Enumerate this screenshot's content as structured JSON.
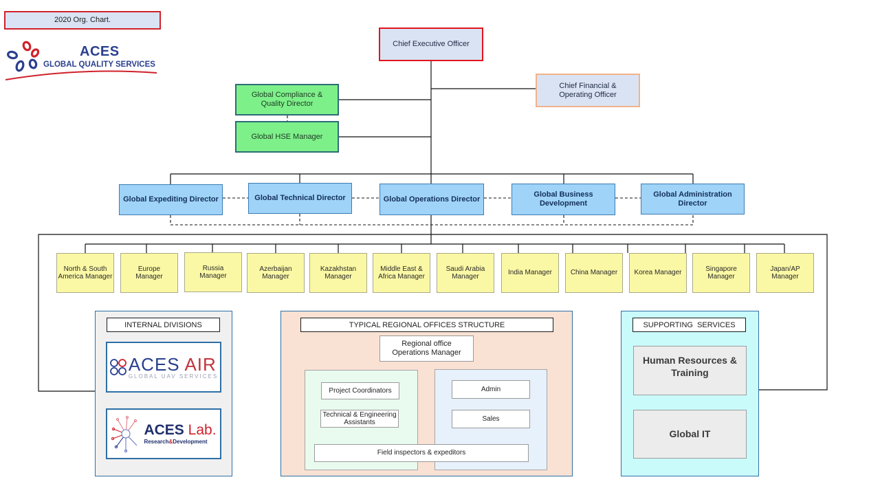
{
  "title": "2020 Org. Chart.",
  "logo": {
    "brand": "ACES",
    "tagline": "GLOBAL QUALITY SERVICES",
    "colors": {
      "blue": "#2a3f8f",
      "red": "#d0212b"
    }
  },
  "executives": {
    "ceo": "Chief Executive Officer",
    "cfo": "Chief Financial & Operating Officer",
    "compliance": "Global Compliance & Quality Director",
    "hse": "Global HSE Manager"
  },
  "directors": [
    "Global Expediting Director",
    "Global Technical Director",
    "Global Operations Director",
    "Global Business Development",
    "Global Administration Director"
  ],
  "managers": [
    "North & South America Manager",
    "Europe Manager",
    "Russia Manager",
    "Azerbaijan Manager",
    "Kazakhstan Manager",
    "Middle East & Africa Manager",
    "Saudi Arabia Manager",
    "India Manager",
    "China Manager",
    "Korea Manager",
    "Singapore Manager",
    "Japan/AP Manager"
  ],
  "internal_divisions": {
    "heading": "INTERNAL DIVISIONS",
    "aces_air": {
      "name_a": "ACES",
      "name_b": "AIR",
      "tagline": "GLOBAL UAV SERVICES"
    },
    "aces_lab": {
      "name_a": "ACES",
      "name_b": "Lab.",
      "tagline_a": "Research",
      "tagline_amp": "&",
      "tagline_b": "Development"
    }
  },
  "regional": {
    "heading": "TYPICAL REGIONAL OFFICES STRUCTURE",
    "manager": "Regional office Operations Manager",
    "project_coordinators": "Project Coordinators",
    "tech_assistants": "Technical & Engineering Assistants",
    "admin": "Admin",
    "sales": "Sales",
    "field": "Field inspectors & expeditors"
  },
  "supporting": {
    "heading": "SUPPORTING  SERVICES",
    "hr": "Human Resources  & Training",
    "it": "Global IT"
  },
  "colors": {
    "ceo_border": "#e0141e",
    "director_fill": "#9fd3f7",
    "manager_fill": "#fbf8a5",
    "green_fill": "#7ef08a",
    "regional_bg": "#f9e1d3",
    "supporting_bg": "#c9fbfb",
    "internal_bg": "#f0f0f0"
  }
}
